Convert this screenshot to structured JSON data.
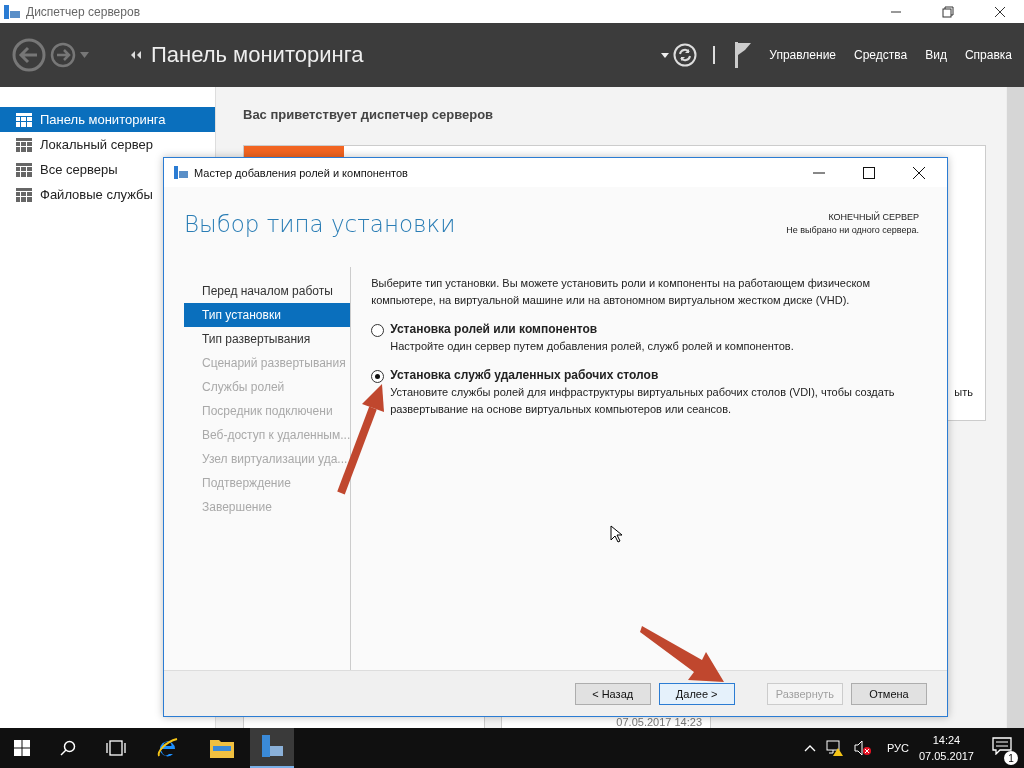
{
  "window": {
    "title": "Диспетчер серверов",
    "breadcrumb": "Панель мониторинга",
    "menu": [
      "Управление",
      "Средства",
      "Вид",
      "Справка"
    ]
  },
  "sidebar": {
    "items": [
      {
        "label": "Панель мониторинга",
        "selected": true
      },
      {
        "label": "Локальный сервер",
        "selected": false
      },
      {
        "label": "Все серверы",
        "selected": false
      },
      {
        "label": "Файловые службы",
        "selected": false
      }
    ]
  },
  "main": {
    "welcome": "Вас приветствует диспетчер серверов",
    "fragment": "ыть",
    "timestamp": "07.05.2017 14:23"
  },
  "dialog": {
    "title": "Мастер добавления ролей и компонентов",
    "heading": "Выбор типа установки",
    "target_label": "КОНЕЧНЫЙ СЕРВЕР",
    "target_value": "Не выбрано ни одного сервера.",
    "steps": [
      {
        "label": "Перед началом работы",
        "selected": false,
        "disabled": false
      },
      {
        "label": "Тип установки",
        "selected": true,
        "disabled": false
      },
      {
        "label": "Тип развертывания",
        "selected": false,
        "disabled": false
      },
      {
        "label": "Сценарий развертывания",
        "selected": false,
        "disabled": true
      },
      {
        "label": "Службы ролей",
        "selected": false,
        "disabled": true
      },
      {
        "label": "Посредник подключени",
        "selected": false,
        "disabled": true
      },
      {
        "label": "Веб-доступ к удаленным...",
        "selected": false,
        "disabled": true
      },
      {
        "label": "Узел виртуализации уда...",
        "selected": false,
        "disabled": true
      },
      {
        "label": "Подтверждение",
        "selected": false,
        "disabled": true
      },
      {
        "label": "Завершение",
        "selected": false,
        "disabled": true
      }
    ],
    "intro": "Выберите тип установки. Вы можете установить роли и компоненты на работающем физическом компьютере, на виртуальной машине или на автономном виртуальном жестком диске (VHD).",
    "options": [
      {
        "title": "Установка ролей или компонентов",
        "description": "Настройте один сервер путем добавления ролей, служб ролей и компонентов.",
        "selected": false
      },
      {
        "title": "Установка служб удаленных рабочих столов",
        "description": "Установите службы ролей для инфраструктуры виртуальных рабочих столов (VDI), чтобы создать развертывание на основе виртуальных компьютеров или сеансов.",
        "selected": true
      }
    ],
    "buttons": [
      {
        "label": "< Назад",
        "disabled": false,
        "focused": false
      },
      {
        "label": "Далее >",
        "disabled": false,
        "focused": true
      },
      {
        "label": "Развернуть",
        "disabled": true,
        "focused": false
      },
      {
        "label": "Отмена",
        "disabled": false,
        "focused": false
      }
    ]
  },
  "taskbar": {
    "language": "РУС",
    "time": "14:24",
    "date": "07.05.2017",
    "notification_count": "1"
  }
}
